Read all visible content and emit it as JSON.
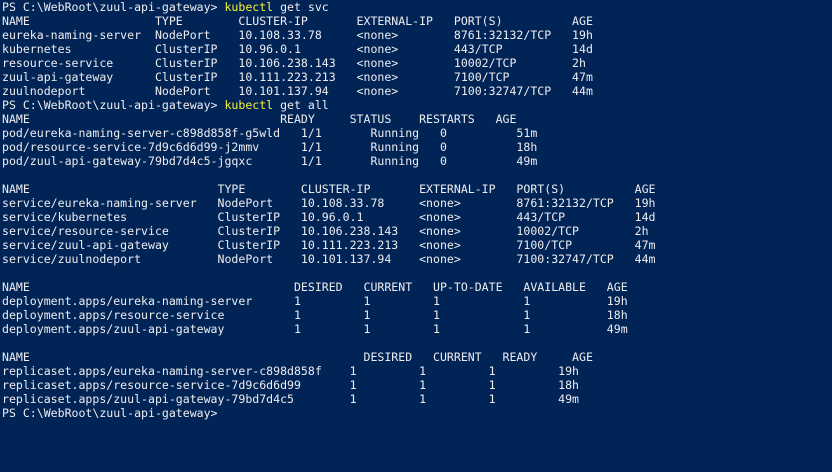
{
  "terminal": {
    "lines": [
      {
        "prompt": "PS C:\\WebRoot\\zuul-api-gateway> ",
        "command": "kubectl",
        "args": " get svc"
      },
      {
        "text": "NAME                  TYPE        CLUSTER-IP       EXTERNAL-IP   PORT(S)          AGE"
      },
      {
        "text": "eureka-naming-server  NodePort    10.108.33.78     <none>        8761:32132/TCP   19h"
      },
      {
        "text": "kubernetes            ClusterIP   10.96.0.1        <none>        443/TCP          14d"
      },
      {
        "text": "resource-service      ClusterIP   10.106.238.143   <none>        10002/TCP        2h"
      },
      {
        "text": "zuul-api-gateway      ClusterIP   10.111.223.213   <none>        7100/TCP         47m"
      },
      {
        "text": "zuulnodeport          NodePort    10.101.137.94    <none>        7100:32747/TCP   44m"
      },
      {
        "prompt": "PS C:\\WebRoot\\zuul-api-gateway> ",
        "command": "kubectl",
        "args": " get all"
      },
      {
        "text": "NAME                                    READY     STATUS    RESTARTS   AGE"
      },
      {
        "text": "pod/eureka-naming-server-c898d858f-g5wld   1/1       Running   0          51m"
      },
      {
        "text": "pod/resource-service-7d9c6d6d99-j2mmv      1/1       Running   0          18h"
      },
      {
        "text": "pod/zuul-api-gateway-79bd7d4c5-jgqxc       1/1       Running   0          49m"
      },
      {
        "text": ""
      },
      {
        "text": "NAME                           TYPE        CLUSTER-IP       EXTERNAL-IP   PORT(S)          AGE"
      },
      {
        "text": "service/eureka-naming-server   NodePort    10.108.33.78     <none>        8761:32132/TCP   19h"
      },
      {
        "text": "service/kubernetes             ClusterIP   10.96.0.1        <none>        443/TCP          14d"
      },
      {
        "text": "service/resource-service       ClusterIP   10.106.238.143   <none>        10002/TCP        2h"
      },
      {
        "text": "service/zuul-api-gateway       ClusterIP   10.111.223.213   <none>        7100/TCP         47m"
      },
      {
        "text": "service/zuulnodeport           NodePort    10.101.137.94    <none>        7100:32747/TCP   44m"
      },
      {
        "text": ""
      },
      {
        "text": "NAME                                      DESIRED   CURRENT   UP-TO-DATE   AVAILABLE   AGE"
      },
      {
        "text": "deployment.apps/eureka-naming-server      1         1         1            1           19h"
      },
      {
        "text": "deployment.apps/resource-service          1         1         1            1           18h"
      },
      {
        "text": "deployment.apps/zuul-api-gateway          1         1         1            1           49m"
      },
      {
        "text": ""
      },
      {
        "text": "NAME                                                DESIRED   CURRENT   READY     AGE"
      },
      {
        "text": "replicaset.apps/eureka-naming-server-c898d858f    1         1         1         19h"
      },
      {
        "text": "replicaset.apps/resource-service-7d9c6d6d99       1         1         1         18h"
      },
      {
        "text": "replicaset.apps/zuul-api-gateway-79bd7d4c5        1         1         1         49m"
      },
      {
        "text": "PS C:\\WebRoot\\zuul-api-gateway>"
      }
    ],
    "colors": {
      "background": "#012456",
      "foreground": "#eeedf0",
      "command": "#f7f135"
    }
  }
}
